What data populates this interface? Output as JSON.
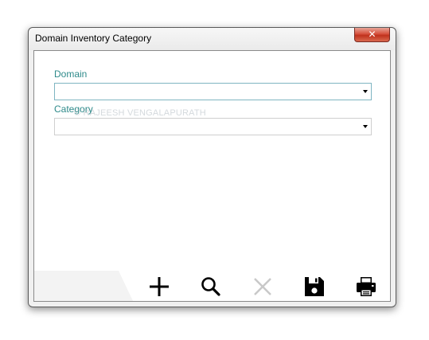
{
  "window": {
    "title": "Domain Inventory Category",
    "close_label": "✕"
  },
  "form": {
    "domain": {
      "label": "Domain",
      "value": ""
    },
    "category": {
      "label": "Category",
      "value": ""
    },
    "watermark": "© RAJEESH VENGALAPURATH"
  },
  "toolbar": {
    "buttons": [
      {
        "name": "add-button",
        "icon": "plus-icon",
        "enabled": true
      },
      {
        "name": "search-button",
        "icon": "search-icon",
        "enabled": true
      },
      {
        "name": "delete-button",
        "icon": "close-icon",
        "enabled": false
      },
      {
        "name": "save-button",
        "icon": "save-icon",
        "enabled": true
      },
      {
        "name": "print-button",
        "icon": "printer-icon",
        "enabled": true
      }
    ]
  },
  "colors": {
    "label_teal": "#2e8a8a",
    "close_red": "#c9422c",
    "disabled_icon": "#c8c8c8"
  }
}
